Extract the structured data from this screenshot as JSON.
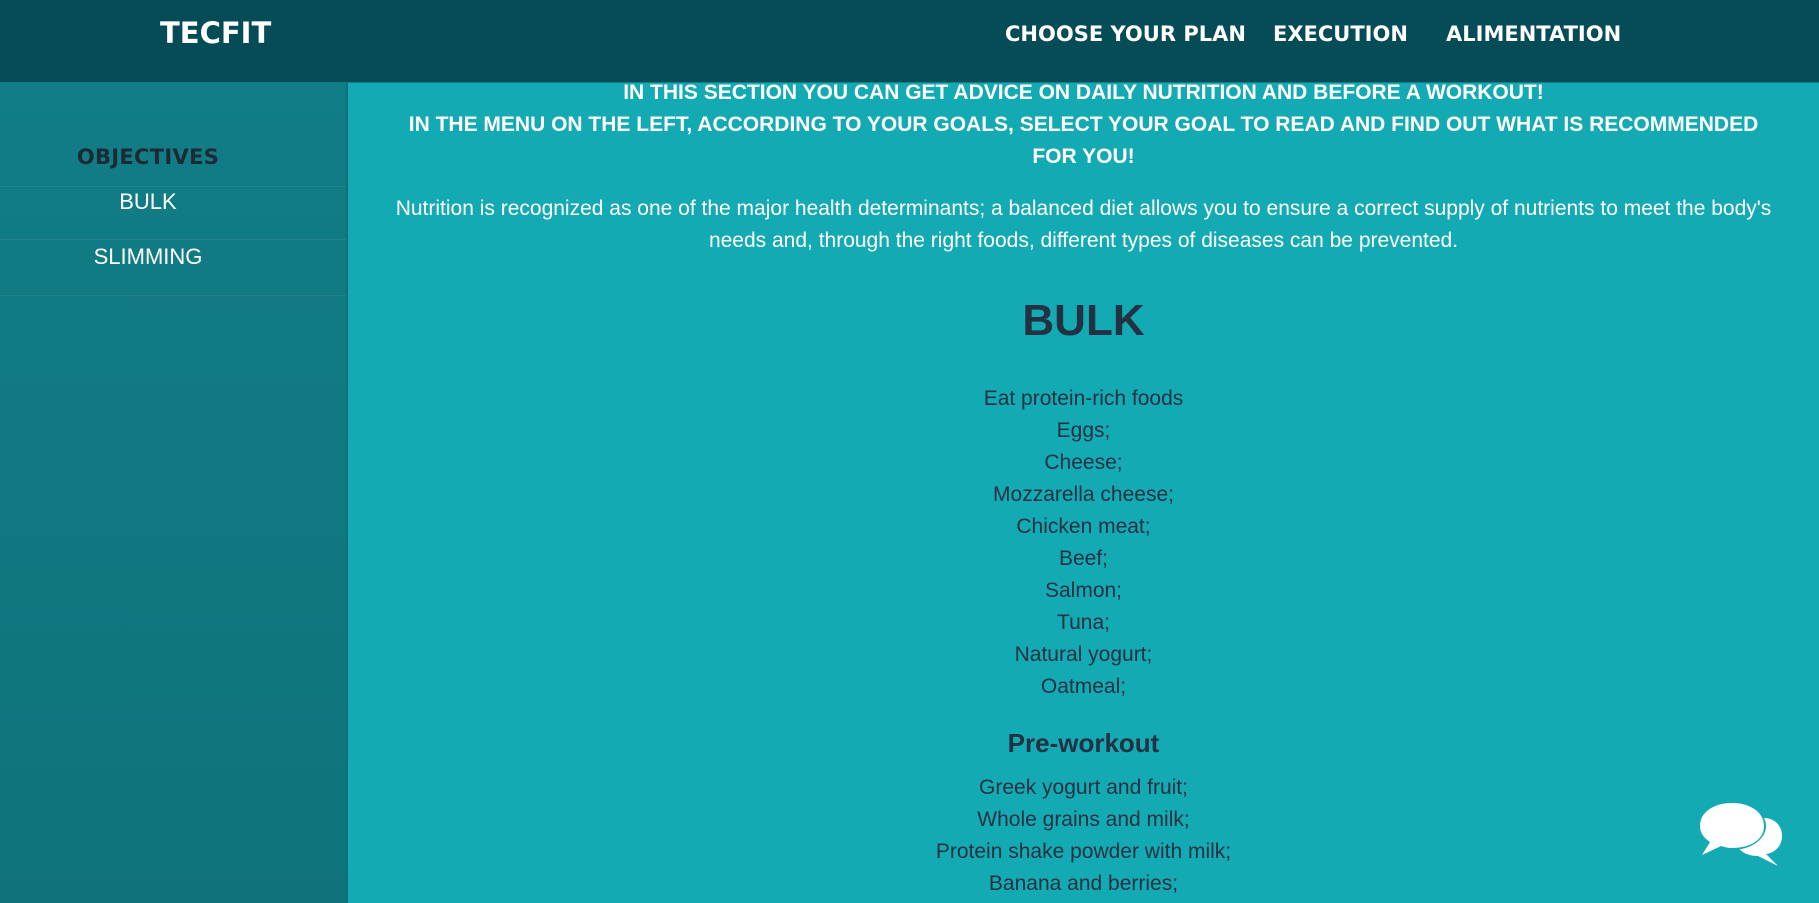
{
  "header": {
    "logo": "TECFIT",
    "nav": [
      {
        "label": "CHOOSE YOUR PLAN"
      },
      {
        "label": "EXECUTION"
      },
      {
        "label": "ALIMENTATION"
      }
    ]
  },
  "sidebar": {
    "title": "OBJECTIVES",
    "items": [
      {
        "label": "BULK"
      },
      {
        "label": "SLIMMING"
      }
    ]
  },
  "main": {
    "intro": [
      "IN THIS SECTION YOU CAN GET ADVICE ON DAILY NUTRITION AND BEFORE A WORKOUT!",
      "IN THE MENU ON THE LEFT, ACCORDING TO YOUR GOALS, SELECT YOUR GOAL TO READ AND FIND OUT WHAT IS RECOMMENDED FOR YOU!"
    ],
    "lead": "Nutrition is recognized as one of the major health determinants; a balanced diet allows you to ensure a correct supply of nutrients to meet the body's needs and, through the right foods, different types of diseases can be prevented.",
    "section_title": "BULK",
    "foods": [
      "Eat protein-rich foods",
      "Eggs;",
      "Cheese;",
      "Mozzarella cheese;",
      "Chicken meat;",
      "Beef;",
      "Salmon;",
      "Tuna;",
      "Natural yogurt;",
      "Oatmeal;"
    ],
    "pre_workout_title": "Pre-workout",
    "pre_workout": [
      "Greek yogurt and fruit;",
      "Whole grains and milk;",
      "Protein shake powder with milk;",
      "Banana and berries;"
    ]
  },
  "chat_button": {
    "icon": "chat-bubbles-icon"
  },
  "colors": {
    "header_bg": "#054c57",
    "sidebar_bg": "#117d86",
    "main_bg": "#13aab4",
    "dark_text": "#233242"
  }
}
